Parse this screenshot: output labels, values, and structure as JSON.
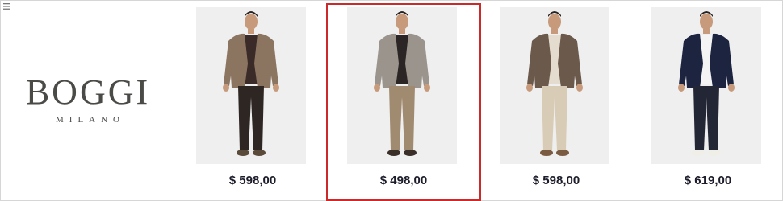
{
  "brand": {
    "name": "BOGGI",
    "city": "MILANO"
  },
  "menu_icon": "hamburger-icon",
  "products": [
    {
      "price": "$ 598,00",
      "jacket": "#8b7460",
      "shirt": "#3a2a28",
      "trousers": "#2e2622",
      "shoes": "#5a4a3a",
      "selected": false
    },
    {
      "price": "$ 498,00",
      "jacket": "#9a948c",
      "shirt": "#2b2525",
      "trousers": "#a08a70",
      "shoes": "#3a2e28",
      "selected": true
    },
    {
      "price": "$ 598,00",
      "jacket": "#6b5a4c",
      "shirt": "#e4dccf",
      "trousers": "#d9ccb6",
      "shoes": "#7a5a40",
      "selected": false
    },
    {
      "price": "$ 619,00",
      "jacket": "#1c2440",
      "shirt": "#f4f4f4",
      "trousers": "#232634",
      "shoes": "#efefe8",
      "selected": false
    }
  ],
  "colors": {
    "selected_border": "#cc2a2a",
    "price_text": "#1c1c2a",
    "logo_text": "#4a4a47"
  }
}
